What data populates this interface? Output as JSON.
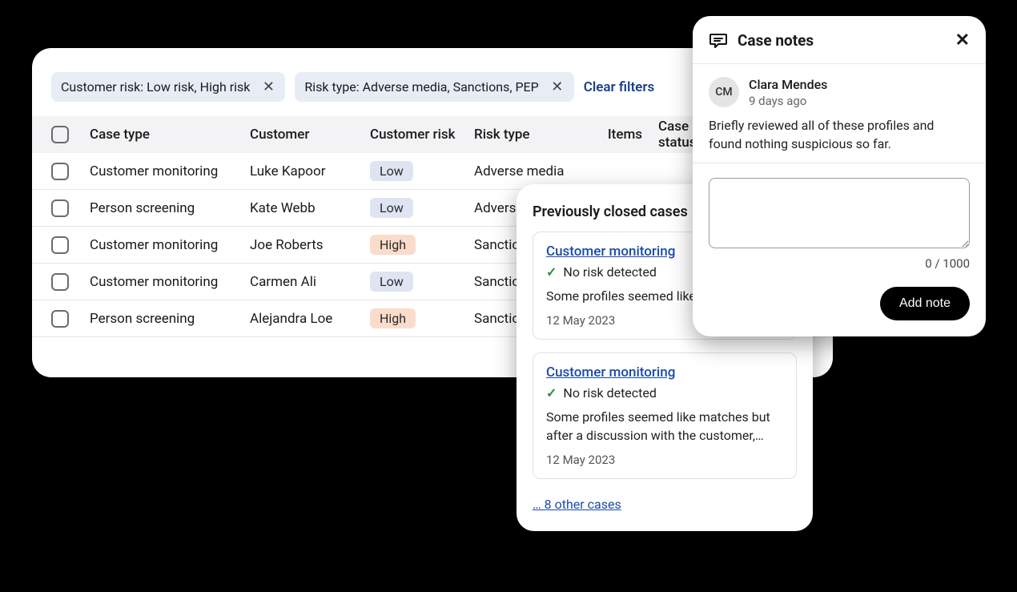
{
  "filters": {
    "chip1": "Customer risk: Low risk, High risk",
    "chip2": "Risk type: Adverse media, Sanctions, PEP",
    "clear": "Clear filters"
  },
  "table": {
    "headers": {
      "case_type": "Case type",
      "customer": "Customer",
      "customer_risk": "Customer risk",
      "risk_type": "Risk type",
      "items": "Items",
      "case_status": "Case status"
    },
    "rows": [
      {
        "case_type": "Customer monitoring",
        "customer": "Luke Kapoor",
        "risk": "Low",
        "risk_class": "low",
        "risk_type": "Adverse media"
      },
      {
        "case_type": "Person screening",
        "customer": "Kate Webb",
        "risk": "Low",
        "risk_class": "low",
        "risk_type": "Adverse media"
      },
      {
        "case_type": "Customer monitoring",
        "customer": "Joe Roberts",
        "risk": "High",
        "risk_class": "high",
        "risk_type": "Sanctions"
      },
      {
        "case_type": "Customer monitoring",
        "customer": "Carmen Ali",
        "risk": "Low",
        "risk_class": "low",
        "risk_type": "Sanctions"
      },
      {
        "case_type": "Person screening",
        "customer": "Alejandra Loe",
        "risk": "High",
        "risk_class": "high",
        "risk_type": "Sanctions"
      }
    ]
  },
  "prev_closed": {
    "heading": "Previously closed cases",
    "cases": [
      {
        "link": "Customer monitoring",
        "risk_label": "No risk detected",
        "desc": "Some profiles seemed like matches but after a discussion with the customer,…",
        "date": "12 May 2023"
      },
      {
        "link": "Customer monitoring",
        "risk_label": "No risk detected",
        "desc": "Some profiles seemed like matches but after a discussion with the customer,…",
        "date": "12 May 2023"
      }
    ],
    "more": "… 8 other cases"
  },
  "notes": {
    "title": "Case notes",
    "author_initials": "CM",
    "author_name": "Clara Mendes",
    "author_time": "9 days ago",
    "note_text": "Briefly reviewed all of these profiles and found nothing suspicious so far.",
    "char_count": "0 / 1000",
    "add_btn": "Add note"
  }
}
